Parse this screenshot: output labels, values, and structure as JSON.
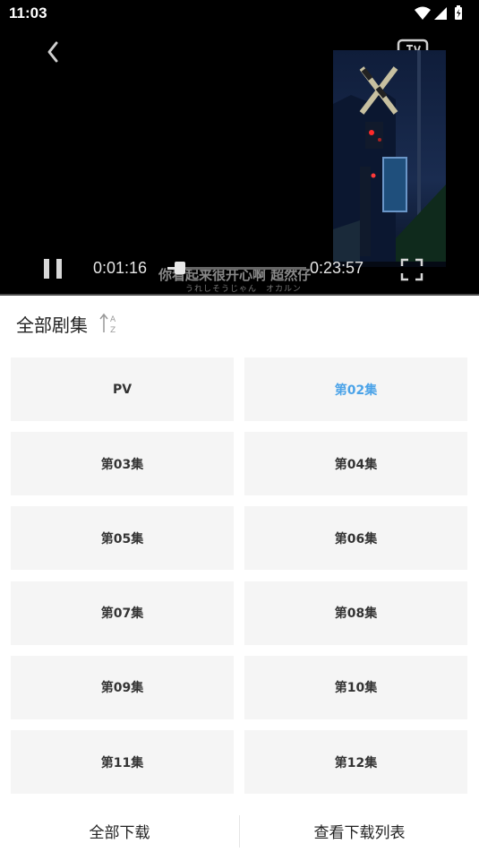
{
  "status_bar": {
    "time": "11:03",
    "icons": [
      "wifi-icon",
      "signal-icon",
      "battery-icon"
    ]
  },
  "player": {
    "back_icon": "chevron-left-icon",
    "cast_icon": "tv-cast-icon",
    "subtitle_main": "你看起来很开心啊 超然仔",
    "subtitle_sub": "うれしそうじゃん　オカルン",
    "current_time": "0:01:16",
    "total_time": "0:23:57",
    "progress_fraction": 0.053,
    "pause_icon": "pause-icon",
    "fullscreen_icon": "fullscreen-icon"
  },
  "panel": {
    "title": "全部剧集",
    "sort_icon": "sort-az-icon",
    "episodes": [
      "PV",
      "第02集",
      "第03集",
      "第04集",
      "第05集",
      "第06集",
      "第07集",
      "第08集",
      "第09集",
      "第10集",
      "第11集",
      "第12集"
    ],
    "active_episode": "第02集",
    "active_color": "#4ba3e8"
  },
  "bottom": {
    "download_all": "全部下载",
    "view_downloads": "查看下载列表"
  }
}
